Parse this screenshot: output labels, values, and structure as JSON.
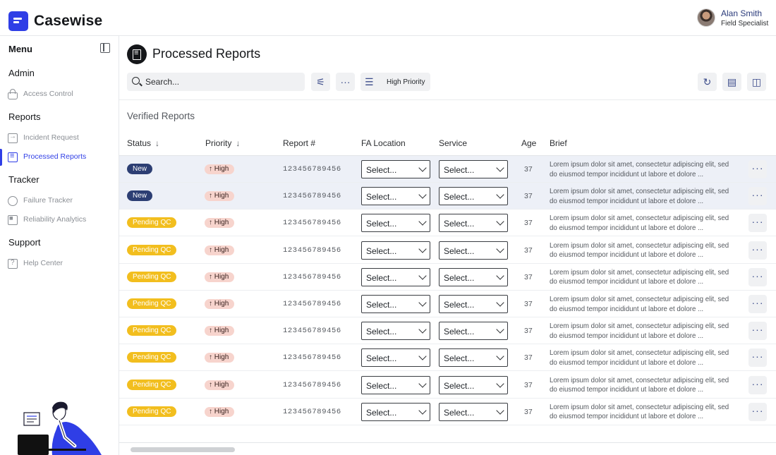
{
  "app": {
    "name": "Casewise"
  },
  "user": {
    "name": "Alan Smith",
    "role": "Field Specialist"
  },
  "sidebar": {
    "menu_label": "Menu",
    "sections": [
      {
        "title": "Admin",
        "items": [
          {
            "label": "Access Control",
            "icon": "lock-icon"
          }
        ]
      },
      {
        "title": "Reports",
        "items": [
          {
            "label": "Incident Request",
            "icon": "incident-icon"
          },
          {
            "label": "Processed Reports",
            "icon": "document-icon",
            "active": true
          }
        ]
      },
      {
        "title": "Tracker",
        "items": [
          {
            "label": "Failure Tracker",
            "icon": "tracker-icon"
          },
          {
            "label": "Reliability Analytics",
            "icon": "analytics-icon"
          }
        ]
      },
      {
        "title": "Support",
        "items": [
          {
            "label": "Help Center",
            "icon": "help-icon"
          }
        ]
      }
    ]
  },
  "page": {
    "title": "Processed Reports",
    "subtitle": "Verified Reports"
  },
  "toolbar": {
    "search_placeholder": "Search...",
    "sort_label": "High Priority"
  },
  "table": {
    "columns": [
      "Status",
      "Priority",
      "Report #",
      "FA Location",
      "Service",
      "Age",
      "Brief"
    ],
    "brief_line1": "Lorem ipsum dolor sit amet, consectetur adipiscing elit, sed",
    "brief_line2": "do eiusmod tempor incididunt ut labore et dolore ...",
    "rows": [
      {
        "status": "New",
        "status_type": "new",
        "priority": "High",
        "report": "123456789456",
        "fa_location": "Select...",
        "service": "Select...",
        "age": "37",
        "highlight": true
      },
      {
        "status": "New",
        "status_type": "new",
        "priority": "High",
        "report": "123456789456",
        "fa_location": "Select...",
        "service": "Select...",
        "age": "37",
        "highlight": true
      },
      {
        "status": "Pending QC",
        "status_type": "pending",
        "priority": "High",
        "report": "123456789456",
        "fa_location": "Select...",
        "service": "Select...",
        "age": "37"
      },
      {
        "status": "Pending QC",
        "status_type": "pending",
        "priority": "High",
        "report": "123456789456",
        "fa_location": "Select...",
        "service": "Select...",
        "age": "37"
      },
      {
        "status": "Pending QC",
        "status_type": "pending",
        "priority": "High",
        "report": "123456789456",
        "fa_location": "Select...",
        "service": "Select...",
        "age": "37"
      },
      {
        "status": "Pending QC",
        "status_type": "pending",
        "priority": "High",
        "report": "123456789456",
        "fa_location": "Select...",
        "service": "Select...",
        "age": "37"
      },
      {
        "status": "Pending QC",
        "status_type": "pending",
        "priority": "High",
        "report": "123456789456",
        "fa_location": "Select...",
        "service": "Select...",
        "age": "37"
      },
      {
        "status": "Pending QC",
        "status_type": "pending",
        "priority": "High",
        "report": "123456789456",
        "fa_location": "Select...",
        "service": "Select...",
        "age": "37"
      },
      {
        "status": "Pending QC",
        "status_type": "pending",
        "priority": "High",
        "report": "123456789456",
        "fa_location": "Select...",
        "service": "Select...",
        "age": "37"
      },
      {
        "status": "Pending QC",
        "status_type": "pending",
        "priority": "High",
        "report": "123456789456",
        "fa_location": "Select...",
        "service": "Select...",
        "age": "37"
      }
    ]
  },
  "colors": {
    "accent": "#2f3ee6",
    "new_badge": "#2c3e73",
    "pending_badge": "#f2be1e",
    "priority_badge": "#f7d4cd"
  }
}
